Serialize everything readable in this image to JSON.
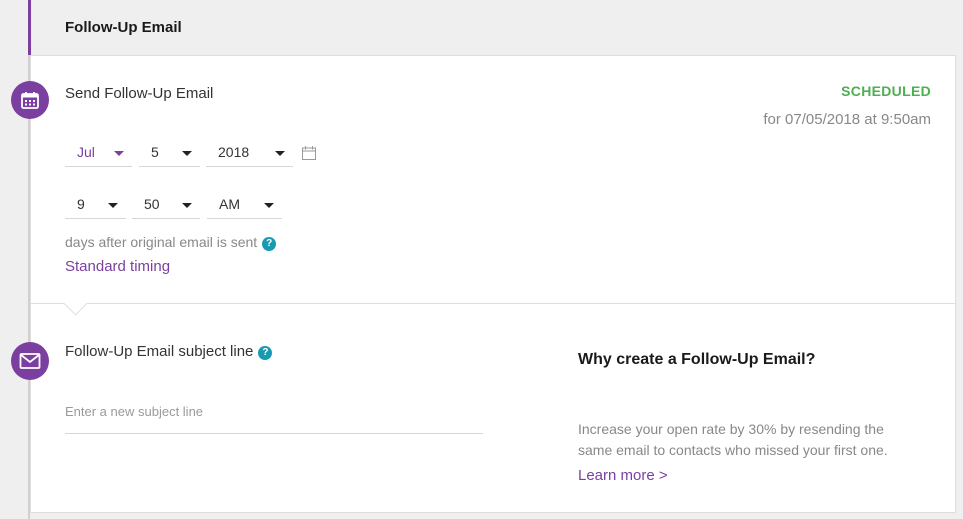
{
  "header": {
    "title": "Follow-Up Email"
  },
  "schedule": {
    "title": "Send Follow-Up Email",
    "status": "SCHEDULED",
    "status_detail": "for 07/05/2018 at 9:50am",
    "date": {
      "month": "Jul",
      "day": "5",
      "year": "2018"
    },
    "time": {
      "hour": "9",
      "minute": "50",
      "ampm": "AM"
    },
    "days_label": "days after original email is sent",
    "help_glyph": "?",
    "standard_timing_link": "Standard timing"
  },
  "subject": {
    "title": "Follow-Up Email subject line",
    "help_glyph": "?",
    "placeholder": "Enter a new subject line",
    "value": ""
  },
  "info": {
    "title": "Why create a Follow-Up Email?",
    "body": "Increase your open rate by 30% by resending the same email to contacts who missed your first one.",
    "learn_more": "Learn more >"
  },
  "colors": {
    "brand": "#7b3fa0",
    "status_green": "#4caf50",
    "help_teal": "#1a9ab0"
  },
  "icons": {
    "schedule_step": "calendar-icon",
    "subject_step": "envelope-icon",
    "date_picker": "calendar-outline-icon"
  }
}
